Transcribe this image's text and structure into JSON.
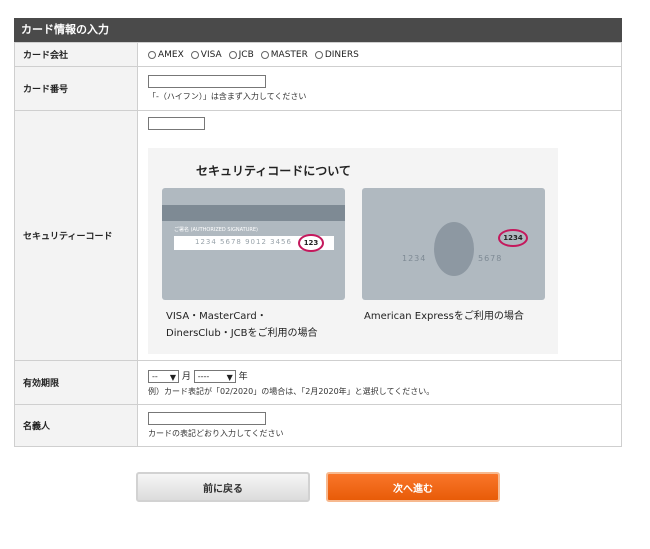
{
  "header": {
    "title": "カード情報の入力"
  },
  "rows": {
    "company": {
      "label": "カード会社",
      "options": [
        "AMEX",
        "VISA",
        "JCB",
        "MASTER",
        "DINERS"
      ]
    },
    "number": {
      "label": "カード番号",
      "value": "",
      "note": "「-（ハイフン）」は含まず入力してください"
    },
    "security": {
      "label": "セキュリティーコード",
      "value": "",
      "info_title": "セキュリティコードについて",
      "card1": {
        "signature_label": "ご署名 (AUTHORIZED SIGNATURE)",
        "number": "1234 5678 9012 3456",
        "code": "123",
        "caption_line1": "VISA・MasterCard・",
        "caption_line2": "DinersClub・JCBをご利用の場合"
      },
      "card2": {
        "code": "1234",
        "number_left": "1234",
        "number_right": "5678",
        "caption": "American Expressをご利用の場合"
      }
    },
    "expiry": {
      "label": "有効期限",
      "month_value": "--",
      "month_unit": "月",
      "year_value": "----",
      "year_unit": "年",
      "note": "例）カード表記が「02/2020」の場合は、「2月2020年」と選択してください。"
    },
    "name": {
      "label": "名義人",
      "value": "",
      "note": "カードの表記どおり入力してください"
    }
  },
  "buttons": {
    "back": "前に戻る",
    "next": "次へ進む"
  },
  "colors": {
    "header": "#4a4a4a",
    "accent": "#ef6a12",
    "code_ring": "#c4185c"
  }
}
